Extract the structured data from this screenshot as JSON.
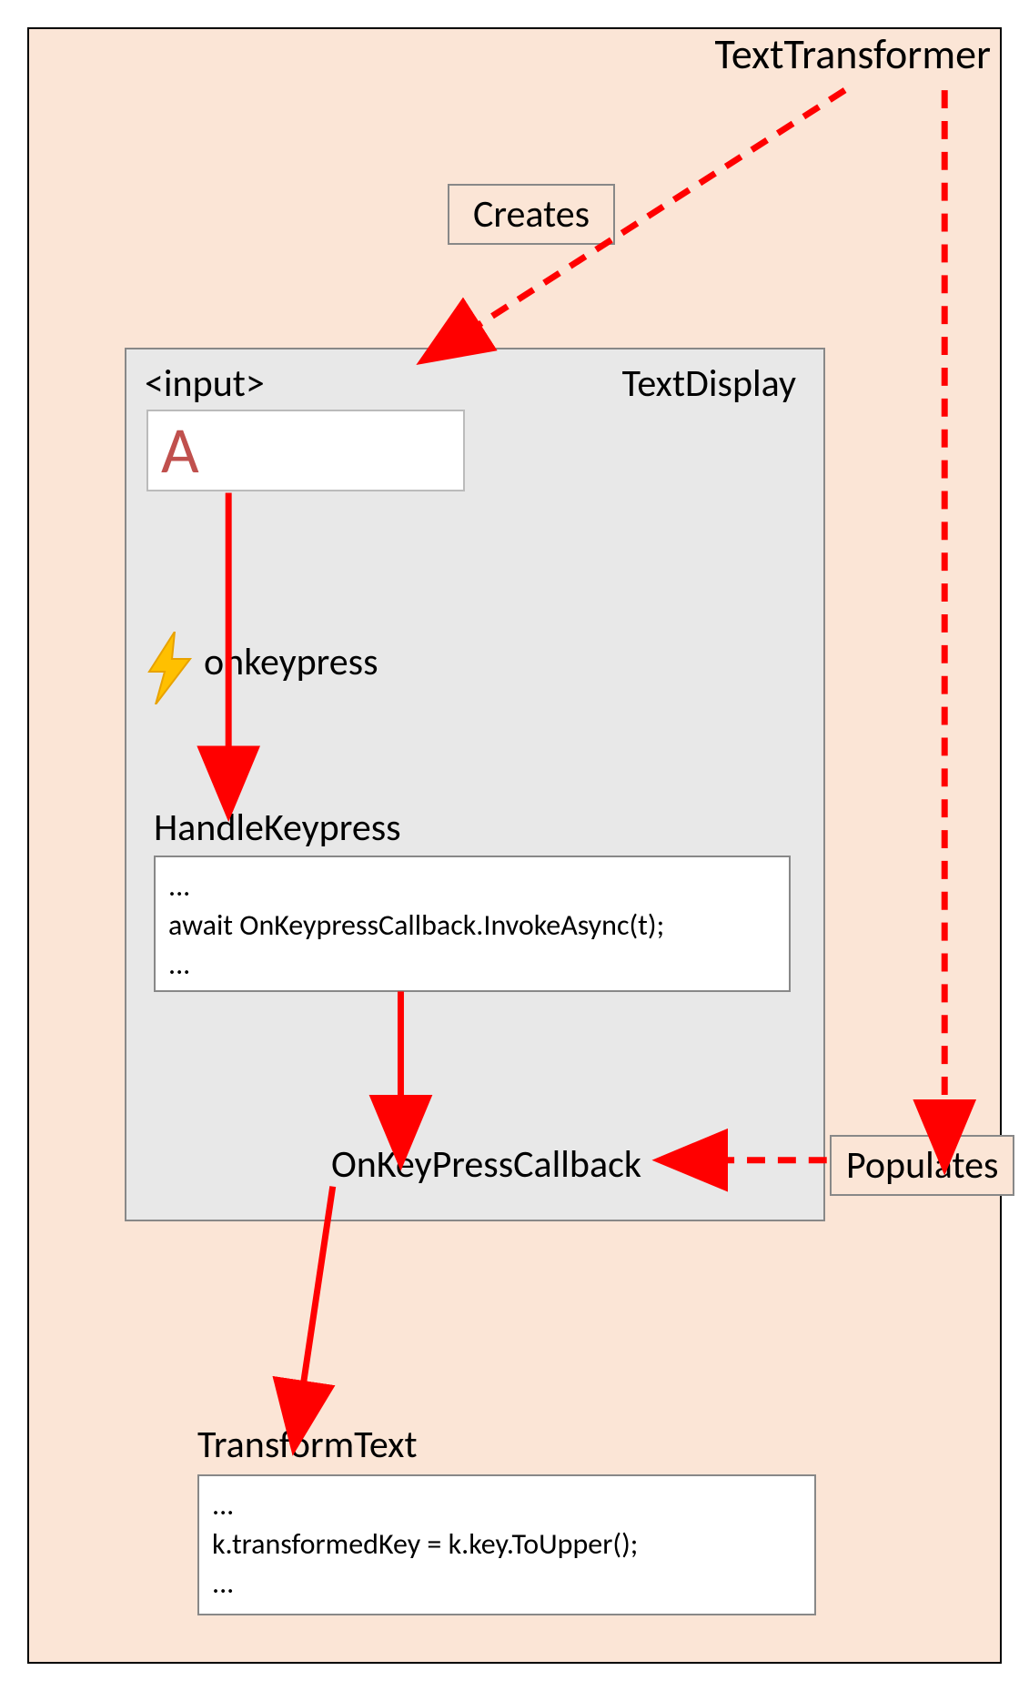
{
  "outer": {
    "title": "TextTransformer",
    "creates_label": "Creates",
    "populates_label": "Populates"
  },
  "inner": {
    "title": "TextDisplay",
    "input_tag": "<input>",
    "input_value": "A",
    "event_name": "onkeypress",
    "handle_keypress": {
      "label": "HandleKeypress",
      "code": "...\nawait OnKeypressCallback.InvokeAsync(t);\n..."
    },
    "callback_label": "OnKeyPressCallback"
  },
  "transform": {
    "label": "TransformText",
    "code": "...\nk.transformedKey = k.key.ToUpper();\n..."
  },
  "icons": {
    "bolt": "lightning-icon"
  },
  "colors": {
    "arrow": "#FF0000",
    "outer_bg": "#FBE5D6",
    "inner_bg": "#E8E8E8",
    "input_letter": "#C0504D"
  }
}
